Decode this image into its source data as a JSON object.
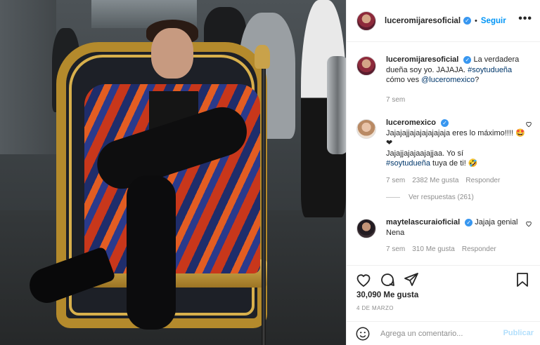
{
  "post": {
    "author": "luceromijaresoficial",
    "follow_label": "Seguir",
    "more_label": "•••",
    "separator": "•",
    "verified_mark": "✓"
  },
  "comments": [
    {
      "user": "luceromijaresoficial",
      "text_before_tag": "La verdadera dueña soy yo. JAJAJA. ",
      "hashtag": "#soytudueña",
      "text_mid": " cómo ves ",
      "mention": "@luceromexico",
      "text_end": "?",
      "time": "7 sem"
    },
    {
      "user": "luceromexico",
      "text_part1": "Jajajajjajajajajajaja eres lo máximo!!!! 🤩❤",
      "text_part2": "Jajajjajajaajajjaa. Yo sí ",
      "hashtag": "#soytudueña",
      "text_end": " tuya de ti! 🤣",
      "time": "7 sem",
      "likes": "2382 Me gusta",
      "reply_label": "Responder",
      "view_replies": "Ver respuestas (261)"
    },
    {
      "user": "maytelascuraioficial",
      "text": "Jajaja genial Nena",
      "time": "7 sem",
      "likes": "310 Me gusta",
      "reply_label": "Responder"
    }
  ],
  "actions": {
    "icons": [
      "heart-icon",
      "comment-icon",
      "share-icon",
      "bookmark-icon"
    ],
    "likes_count": "30,090 Me gusta",
    "date": "4 DE MARZO"
  },
  "add_comment": {
    "placeholder": "Agrega un comentario...",
    "publish_label": "Publicar"
  },
  "colors": {
    "link_blue": "#0095f6",
    "verified_blue": "#3897f0",
    "tag_blue": "#00376b",
    "meta_gray": "#8e8e8e",
    "publish_disabled": "#b2dffc"
  }
}
